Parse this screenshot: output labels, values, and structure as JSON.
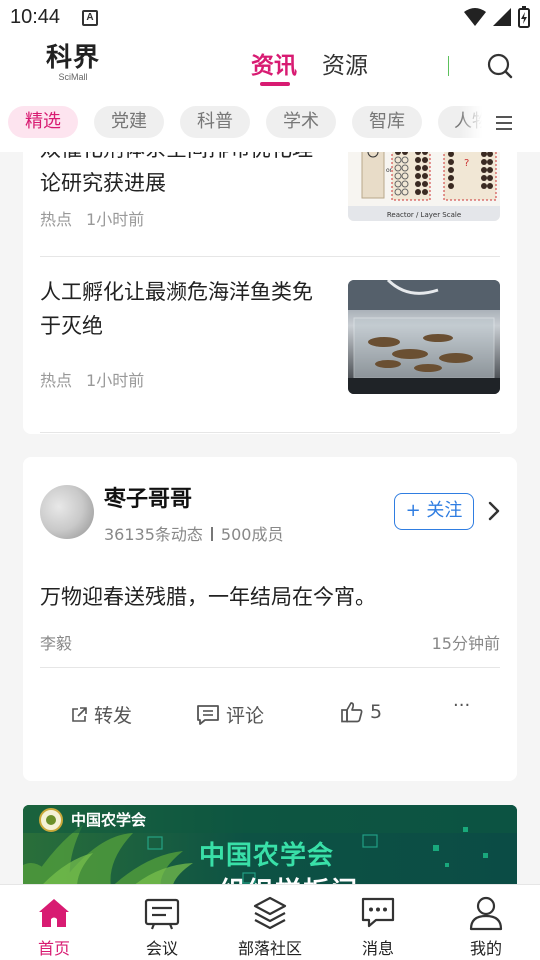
{
  "status_bar": {
    "time": "10:44",
    "notification_icon": "A"
  },
  "header": {
    "logo_cn": "科界",
    "logo_en": "SciMall",
    "tabs": [
      {
        "label": "资讯",
        "active": true
      },
      {
        "label": "资源",
        "active": false
      }
    ],
    "search_icon": "search-icon"
  },
  "categories": [
    {
      "label": "精选",
      "active": true
    },
    {
      "label": "党建",
      "active": false
    },
    {
      "label": "科普",
      "active": false
    },
    {
      "label": "学术",
      "active": false
    },
    {
      "label": "智库",
      "active": false
    },
    {
      "label": "人物",
      "active": false
    }
  ],
  "news": [
    {
      "title": "双催化剂体系空间排布优化理论研究获进展",
      "tag": "热点",
      "time": "1小时前",
      "image_caption": "Reactor / Layer Scale"
    },
    {
      "title": "人工孵化让最濒危海洋鱼类免于灭绝",
      "tag": "热点",
      "time": "1小时前"
    }
  ],
  "group_post": {
    "group_name": "枣子哥哥",
    "post_count": "36135条动态",
    "member_count": "500成员",
    "follow_label": "+ 关注",
    "content": "万物迎春送残腊，一年结局在今宵。",
    "author": "李毅",
    "time": "15分钟前",
    "actions": {
      "share": "转发",
      "comment": "评论",
      "like_count": "5",
      "more": "···"
    }
  },
  "banner": {
    "org_name": "中国农学会",
    "headline": "中国农学会",
    "subline": "组织样板间"
  },
  "bottom_nav": [
    {
      "label": "首页",
      "icon": "home-icon",
      "active": true
    },
    {
      "label": "会议",
      "icon": "meeting-icon",
      "active": false
    },
    {
      "label": "部落社区",
      "icon": "layers-icon",
      "active": false
    },
    {
      "label": "消息",
      "icon": "message-icon",
      "active": false
    },
    {
      "label": "我的",
      "icon": "profile-icon",
      "active": false
    }
  ],
  "colors": {
    "accent": "#d81b72",
    "follow_blue": "#2f7de1"
  }
}
